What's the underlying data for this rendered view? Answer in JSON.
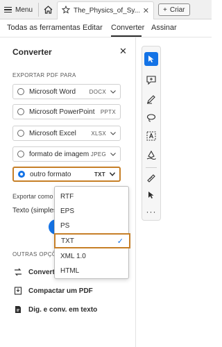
{
  "topbar": {
    "menu_label": "Menu",
    "tab_title": "The_Physics_of_Sy...",
    "create_label": "Criar"
  },
  "menubar": {
    "items": [
      "Todas as ferramentas",
      "Editar",
      "Converter",
      "Assinar"
    ],
    "active": "Converter"
  },
  "panel": {
    "title": "Converter",
    "export_section": "EXPORTAR PDF PARA",
    "options": [
      {
        "label": "Microsoft Word",
        "ext": "DOCX",
        "selected": false,
        "has_chevron": true
      },
      {
        "label": "Microsoft PowerPoint",
        "ext": "PPTX",
        "selected": false,
        "has_chevron": false
      },
      {
        "label": "Microsoft Excel",
        "ext": "XLSX",
        "selected": false,
        "has_chevron": true
      },
      {
        "label": "formato de imagem",
        "ext": "JPEG",
        "selected": false,
        "has_chevron": true
      },
      {
        "label": "outro formato",
        "ext": "TXT",
        "selected": true,
        "has_chevron": true
      }
    ],
    "export_as_label": "Exportar como",
    "export_as_value": "Texto (simples)",
    "other_options_label": "OUTRAS OPÇÕES",
    "links": [
      {
        "label": "Converter",
        "icon": "convert-icon"
      },
      {
        "label": "Compactar um PDF",
        "icon": "compress-icon"
      },
      {
        "label": "Dig. e conv. em texto",
        "icon": "scan-text-icon"
      }
    ]
  },
  "dropdown": {
    "items": [
      "RTF",
      "EPS",
      "PS",
      "TXT",
      "XML 1.0",
      "HTML"
    ],
    "selected": "TXT"
  },
  "toolbar": {
    "tools": [
      "select-arrow-icon",
      "add-comment-icon",
      "draw-pen-icon",
      "lasso-icon",
      "text-select-icon",
      "signature-pen-icon",
      "measure-icon",
      "pointer-icon",
      "more-icon"
    ]
  },
  "colors": {
    "accent": "#1473e6",
    "highlight": "#c67f27"
  }
}
